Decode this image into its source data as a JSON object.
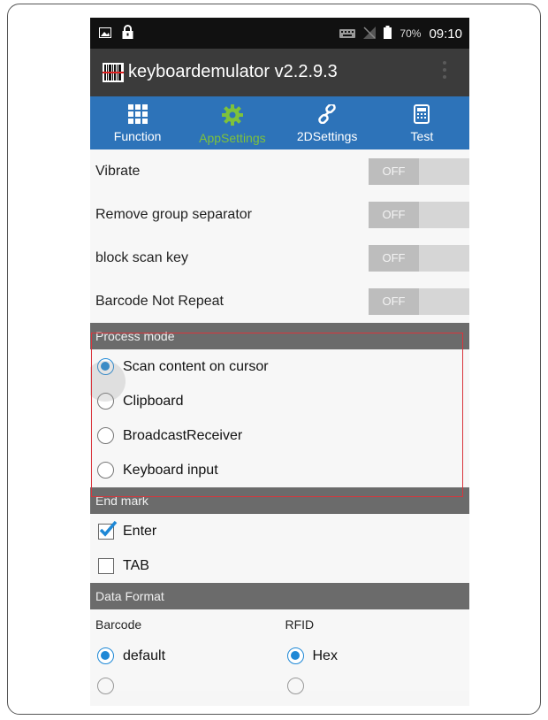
{
  "status_bar": {
    "battery_pct": "70%",
    "time": "09:10"
  },
  "app": {
    "title": "keyboardemulator v2.2.9.3"
  },
  "tabs": [
    {
      "label": "Function",
      "icon": "grid-icon",
      "active": false
    },
    {
      "label": "AppSettings",
      "icon": "gear-icon",
      "active": true
    },
    {
      "label": "2DSettings",
      "icon": "link-icon",
      "active": false
    },
    {
      "label": "Test",
      "icon": "calculator-icon",
      "active": false
    }
  ],
  "settings": [
    {
      "label": "Vibrate",
      "state": "OFF"
    },
    {
      "label": "Remove group separator",
      "state": "OFF"
    },
    {
      "label": "block scan key",
      "state": "OFF"
    },
    {
      "label": "Barcode Not Repeat",
      "state": "OFF"
    }
  ],
  "process_mode": {
    "header": "Process mode",
    "options": [
      {
        "label": "Scan content on cursor",
        "selected": true
      },
      {
        "label": "Clipboard",
        "selected": false
      },
      {
        "label": "BroadcastReceiver",
        "selected": false
      },
      {
        "label": "Keyboard input",
        "selected": false
      }
    ]
  },
  "end_mark": {
    "header": "End mark",
    "options": [
      {
        "label": "Enter",
        "checked": true
      },
      {
        "label": "TAB",
        "checked": false
      }
    ]
  },
  "data_format": {
    "header": "Data Format",
    "barcode_label": "Barcode",
    "rfid_label": "RFID",
    "barcode_selected": "default",
    "rfid_selected": "Hex"
  },
  "colors": {
    "tab_bar": "#2d73b9",
    "active_tab": "#7ec23b",
    "section_header": "#6b6b6b",
    "radio_accent": "#1e88d6",
    "highlight_box": "#d9353c"
  }
}
